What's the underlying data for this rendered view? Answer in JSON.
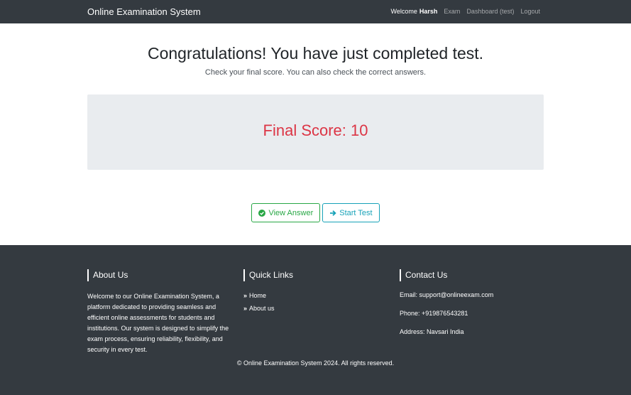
{
  "navbar": {
    "brand": "Online Examination System",
    "welcome_prefix": "Welcome",
    "username": "Harsh",
    "links": [
      "Exam",
      "Dashboard (test)",
      "Logout"
    ]
  },
  "main": {
    "headline": "Congratulations! You have just completed test.",
    "subline": "Check your final score. You can also check the correct answers.",
    "score_text": "Final Score: 10",
    "view_answer_label": "View Answer",
    "start_test_label": "Start Test"
  },
  "footer": {
    "about": {
      "heading": "About Us",
      "text": "Welcome to our Online Examination System, a platform dedicated to providing seamless and efficient online assessments for students and institutions. Our system is designed to simplify the exam process, ensuring reliability, flexibility, and security in every test."
    },
    "quick_links": {
      "heading": "Quick Links",
      "items": [
        "Home",
        "About us"
      ]
    },
    "contact": {
      "heading": "Contact Us",
      "email": "Email: support@onlineexam.com",
      "phone": "Phone: +919876543281",
      "address": "Address: Navsari India"
    },
    "copyright": "© Online Examination System 2024. All rights reserved."
  },
  "colors": {
    "navbar_bg": "#343a40",
    "score_red": "#dc3545",
    "success_green": "#28a745",
    "info_teal": "#17a2b8",
    "jumbotron_bg": "#e9ecef"
  },
  "icons": {
    "view_answer": "check-circle-icon",
    "start_test": "arrow-right-icon",
    "quick_link": "double-chevron-right-icon"
  }
}
